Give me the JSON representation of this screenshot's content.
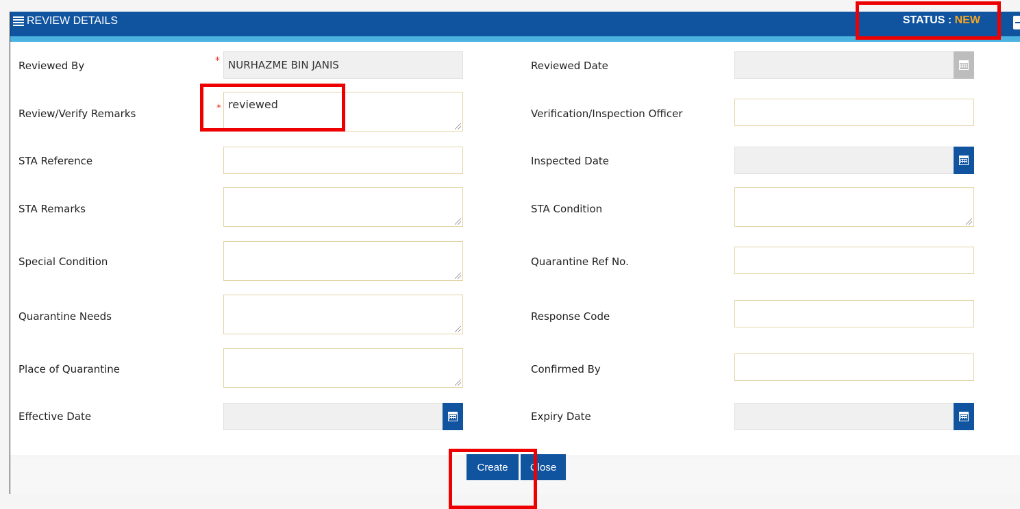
{
  "header": {
    "title": "REVIEW DETAILS",
    "status_label": "STATUS :",
    "status_value": "NEW"
  },
  "left_fields": [
    {
      "label": "Reviewed By",
      "value": "NURHAZME BIN JANIS",
      "required": true
    },
    {
      "label": "Review/Verify Remarks",
      "value": "reviewed",
      "required": true
    },
    {
      "label": "STA Reference",
      "value": ""
    },
    {
      "label": "STA Remarks",
      "value": ""
    },
    {
      "label": "Special Condition",
      "value": ""
    },
    {
      "label": "Quarantine Needs",
      "value": ""
    },
    {
      "label": "Place of Quarantine",
      "value": ""
    },
    {
      "label": "Effective Date",
      "value": ""
    }
  ],
  "right_fields": [
    {
      "label": "Reviewed Date",
      "value": ""
    },
    {
      "label": "Verification/Inspection Officer",
      "value": ""
    },
    {
      "label": "Inspected Date",
      "value": ""
    },
    {
      "label": "STA Condition",
      "value": ""
    },
    {
      "label": "Quarantine Ref No.",
      "value": ""
    },
    {
      "label": "Response Code",
      "value": ""
    },
    {
      "label": "Confirmed By",
      "value": ""
    },
    {
      "label": "Expiry Date",
      "value": ""
    }
  ],
  "buttons": {
    "create": "Create",
    "close": "Close"
  },
  "required_marker": "*",
  "colors": {
    "header": "#1054a0",
    "stripe": "#4cb3e0",
    "status_value": "#f5a623",
    "highlight": "#e00000"
  }
}
